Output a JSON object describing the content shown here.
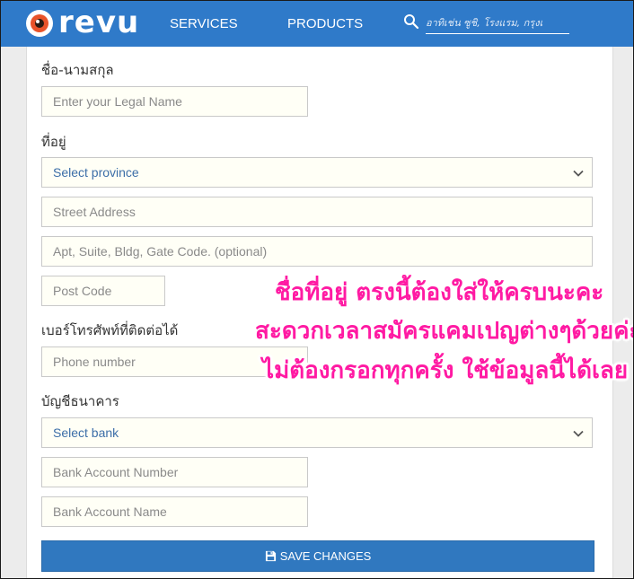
{
  "brand": {
    "name": "revu"
  },
  "nav": {
    "services": "SERVICES",
    "products": "PRODUCTS",
    "search_placeholder": "อาทิเช่น ซูชิ, โรงแรม, กรุงเ"
  },
  "form": {
    "name_section": {
      "label": "ชื่อ-นามสกุล",
      "legal_name_placeholder": "Enter your Legal Name"
    },
    "address_section": {
      "label": "ที่อยู่",
      "province_select": "Select province",
      "street_placeholder": "Street Address",
      "apt_placeholder": "Apt, Suite, Bldg, Gate Code. (optional)",
      "postcode_placeholder": "Post Code"
    },
    "phone_section": {
      "label": "เบอร์โทรศัพท์ที่ติดต่อได้",
      "phone_placeholder": "Phone number"
    },
    "bank_section": {
      "label": "บัญชีธนาคาร",
      "bank_select": "Select bank",
      "account_number_placeholder": "Bank Account Number",
      "account_name_placeholder": "Bank Account Name"
    },
    "save_label": "SAVE CHANGES"
  },
  "overlay_caption": {
    "line1": "ชื่อที่อยู่ ตรงนี้ต้องใส่ให้ครบนะคะ",
    "line2": "สะดวกเวลาสมัครแคมเปญต่างๆด้วยค่ะ",
    "line3": "ไม่ต้องกรอกทุกครั้ง ใช้ข้อมูลนี้ได้เลย"
  },
  "colors": {
    "navbar": "#2f7ac9",
    "save_button": "#3078bf",
    "field_background": "#fffff6",
    "caption": "#ff1aa3"
  },
  "icons": [
    "revu-eye-logo-icon",
    "search-icon",
    "chevron-down-icon",
    "floppy-disk-icon"
  ]
}
